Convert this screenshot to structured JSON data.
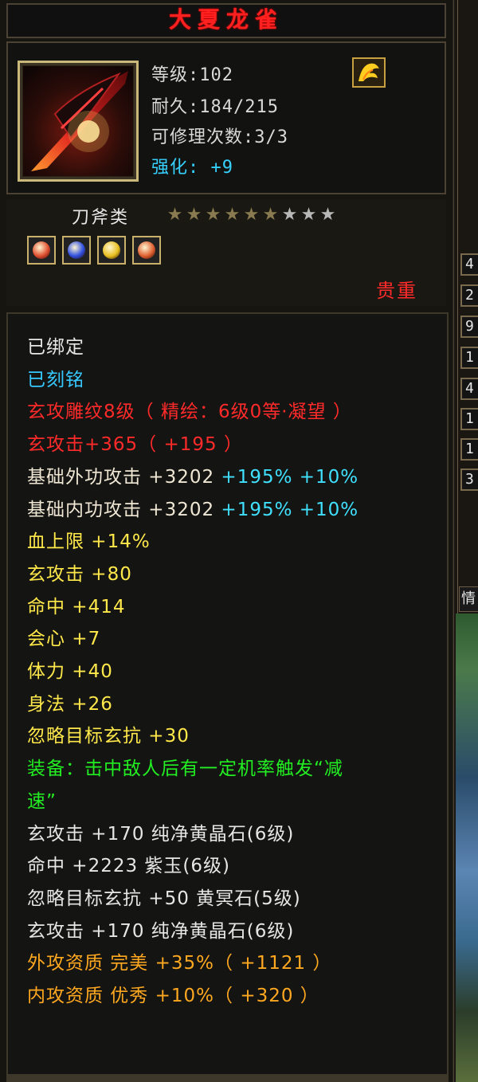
{
  "item": {
    "name": "大夏龙雀",
    "level": "等级:102",
    "durability": "耐久:184/215",
    "repairs": "可修理次数:3/3",
    "enhance": "强化: +9",
    "category": "刀斧类",
    "stars_filled": 6,
    "stars_total": 9,
    "rarity": "贵重"
  },
  "gems": [
    {
      "icon": "red-orb-gem-icon",
      "color": "#e05030"
    },
    {
      "icon": "blue-orb-gem-icon",
      "color": "#3050e0"
    },
    {
      "icon": "yellow-orb-gem-icon",
      "color": "#e8c020"
    },
    {
      "icon": "red-orb-gem-icon",
      "color": "#e06030"
    }
  ],
  "attributes": [
    {
      "text": "已绑定",
      "color": "white"
    },
    {
      "text": "已刻铭",
      "color": "cyan"
    },
    {
      "text": "玄攻雕纹8级（ 精绘：6级0等·凝望 ）",
      "color": "red"
    },
    {
      "text": "玄攻击+365（ +195 ）",
      "color": "red"
    },
    {
      "text": "基础外功攻击 +3202",
      "extra": " +195% +10%",
      "color": "beige"
    },
    {
      "text": "基础内功攻击 +3202",
      "extra": " +195% +10%",
      "color": "beige"
    },
    {
      "text": "血上限 +14%",
      "color": "yellow"
    },
    {
      "text": "玄攻击 +80",
      "color": "yellow"
    },
    {
      "text": "命中 +414",
      "color": "yellow"
    },
    {
      "text": "会心 +7",
      "color": "yellow"
    },
    {
      "text": "体力 +40",
      "color": "yellow"
    },
    {
      "text": "身法 +26",
      "color": "yellow"
    },
    {
      "text": "忽略目标玄抗 +30",
      "color": "yellow"
    },
    {
      "text": "装备：击中敌人后有一定机率触发“减",
      "color": "green"
    },
    {
      "text": "速”",
      "color": "green"
    },
    {
      "text": "玄攻击 +170 纯净黄晶石(6级)",
      "color": "white"
    },
    {
      "text": "命中 +2223 紫玉(6级)",
      "color": "white"
    },
    {
      "text": "忽略目标玄抗 +50 黄冥石(5级)",
      "color": "white"
    },
    {
      "text": "玄攻击 +170 纯净黄晶石(6级)",
      "color": "white"
    },
    {
      "text": "外攻资质  完美 +35%（ +1121 ）",
      "color": "orange"
    },
    {
      "text": "内攻资质  优秀 +10%（ +320 ）",
      "color": "orange"
    }
  ],
  "side_slots": [
    "4",
    "2",
    "9",
    "1",
    "4",
    "1",
    "1",
    "3"
  ],
  "side_label": "情"
}
